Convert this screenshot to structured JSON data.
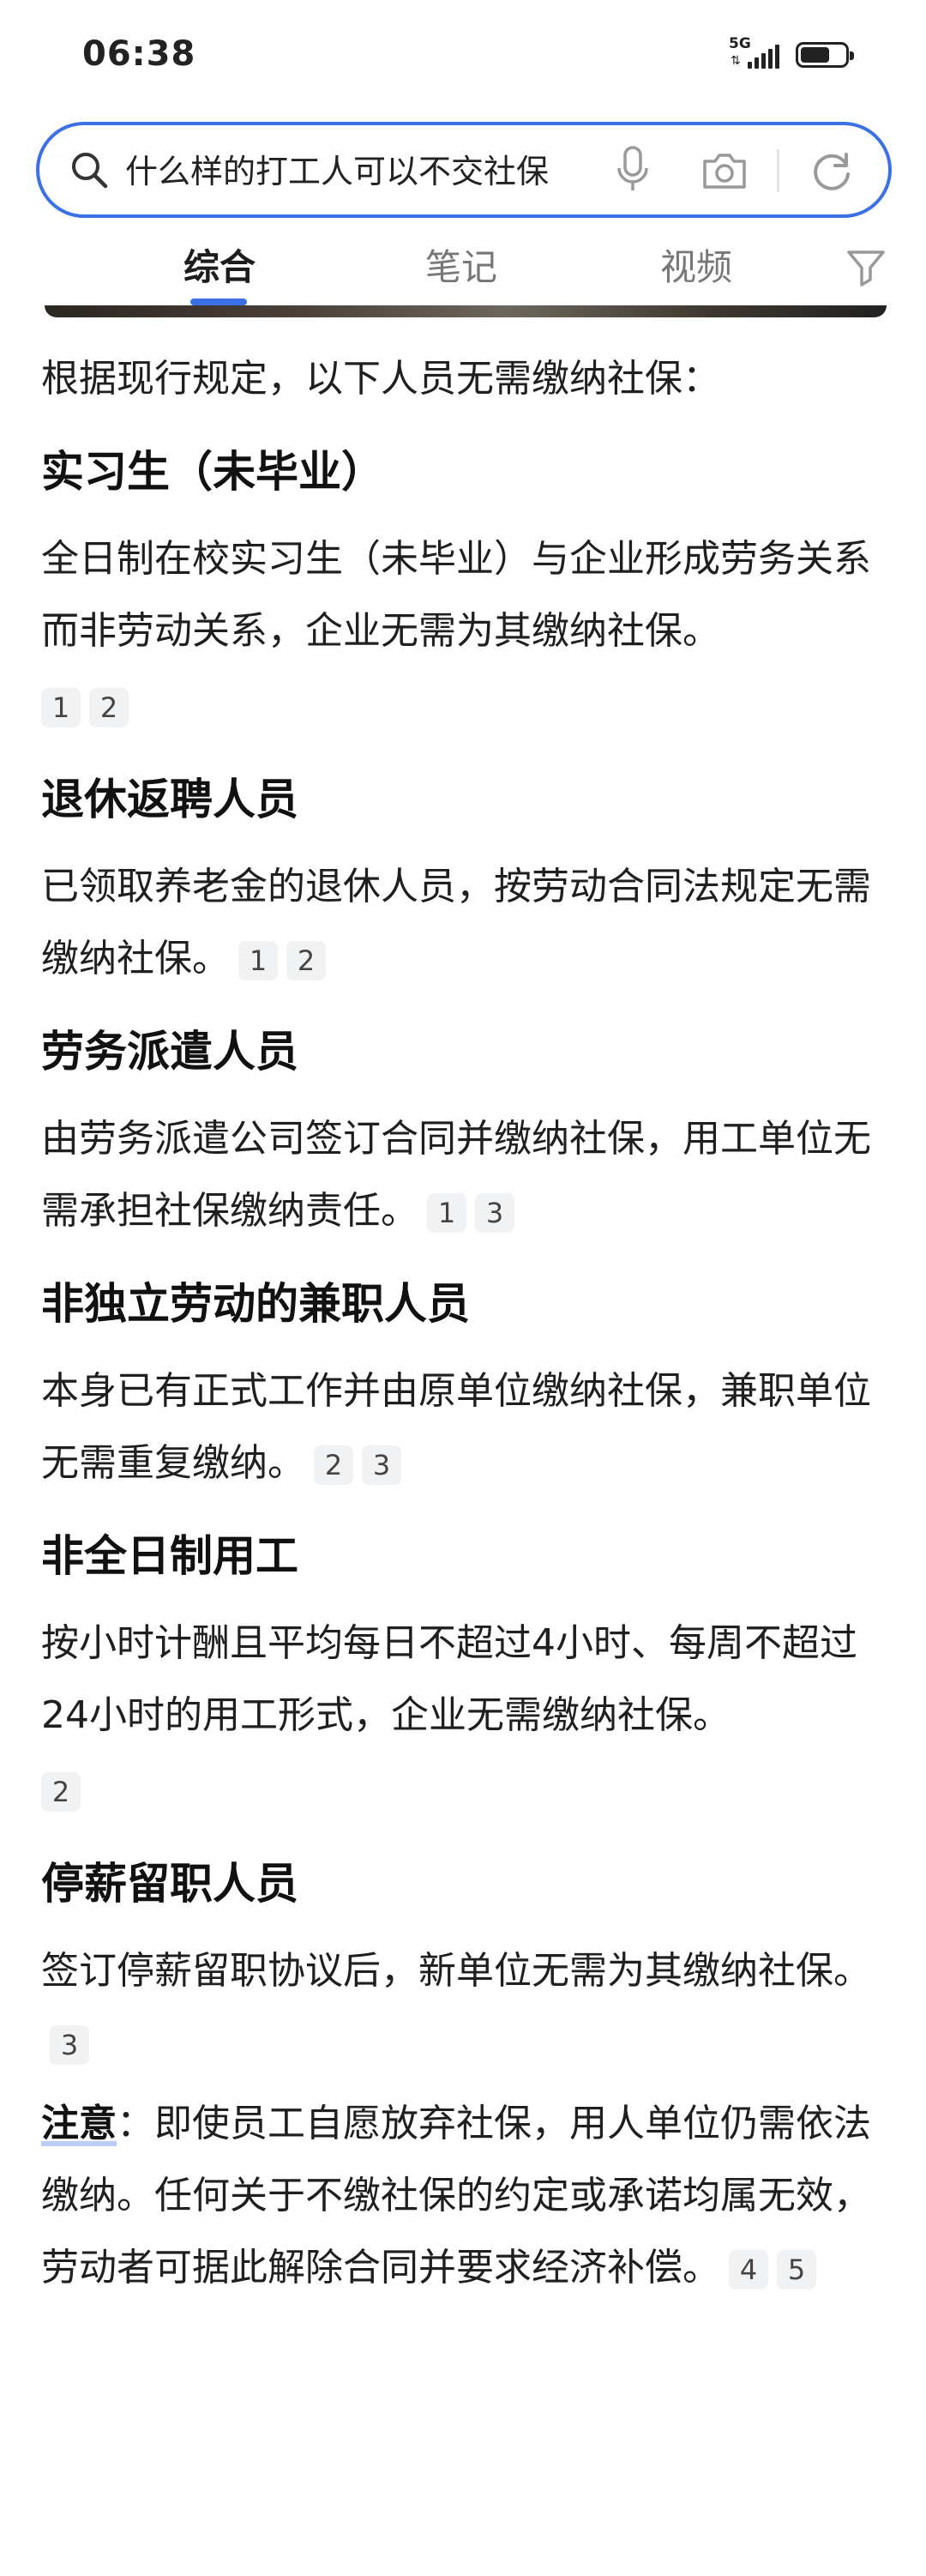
{
  "status_bar": {
    "time": "06:38",
    "network": "5G",
    "battery_level": 0.65
  },
  "search": {
    "query": "什么样的打工人可以不交社保"
  },
  "tabs": [
    {
      "label": "综合",
      "active": true
    },
    {
      "label": "笔记",
      "active": false
    },
    {
      "label": "视频",
      "active": false
    }
  ],
  "content": {
    "intro": "根据现行规定，以下人员无需缴纳社保：",
    "sections": [
      {
        "title": "实习生（未毕业）",
        "body": "全日制在校实习生（未毕业）与企业形成劳务关系而非劳动关系，企业无需为其缴纳社保。",
        "citations": [
          "1",
          "2"
        ]
      },
      {
        "title": "退休返聘人员",
        "body": "已领取养老金的退休人员，按劳动合同法规定无需缴纳社保。",
        "citations": [
          "1",
          "2"
        ]
      },
      {
        "title": "劳务派遣人员",
        "body": "由劳务派遣公司签订合同并缴纳社保，用工单位无需承担社保缴纳责任。",
        "citations": [
          "1",
          "3"
        ]
      },
      {
        "title": "非独立劳动的兼职人员",
        "body": "本身已有正式工作并由原单位缴纳社保，兼职单位无需重复缴纳。",
        "citations": [
          "2",
          "3"
        ]
      },
      {
        "title": "非全日制用工",
        "body": "按小时计酬且平均每日不超过4小时、每周不超过24小时的用工形式，企业无需缴纳社保。",
        "citations": [
          "2"
        ]
      },
      {
        "title": "停薪留职人员",
        "body": "签订停薪留职协议后，新单位无需为其缴纳社保。",
        "citations": [
          "3"
        ]
      }
    ],
    "note": {
      "label": "注意",
      "separator": "：",
      "body": "即使员工自愿放弃社保，用人单位仍需依法缴纳。任何关于不缴社保的约定或承诺均属无效，劳动者可据此解除合同并要求经济补偿。",
      "citations": [
        "4",
        "5"
      ]
    }
  },
  "colors": {
    "accent": "#3b71e4",
    "citation_bg": "#f1f2f4"
  }
}
